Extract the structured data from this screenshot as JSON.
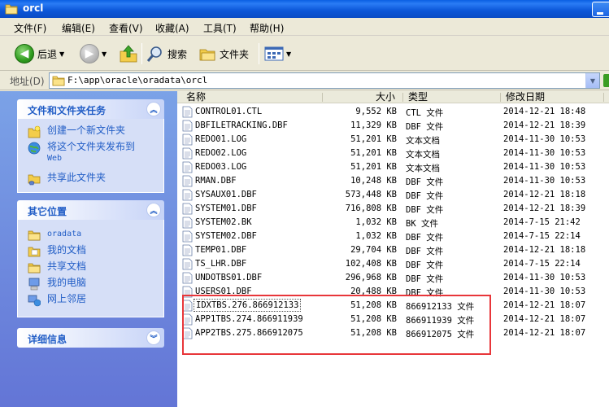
{
  "window": {
    "title": "orcl"
  },
  "menu": [
    {
      "label": "文件(F)"
    },
    {
      "label": "编辑(E)"
    },
    {
      "label": "查看(V)"
    },
    {
      "label": "收藏(A)"
    },
    {
      "label": "工具(T)"
    },
    {
      "label": "帮助(H)"
    }
  ],
  "toolbar": {
    "back_label": "后退",
    "search_label": "搜索",
    "folders_label": "文件夹"
  },
  "address": {
    "label": "地址(D)",
    "path": "F:\\app\\oracle\\oradata\\orcl"
  },
  "tasks": {
    "file_tasks": {
      "title": "文件和文件夹任务",
      "items": [
        {
          "label": "创建一个新文件夹",
          "icon": "new-folder-icon"
        },
        {
          "label": "将这个文件夹发布到",
          "label2": "Web",
          "icon": "publish-web-icon"
        },
        {
          "label": "共享此文件夹",
          "icon": "share-folder-icon"
        }
      ]
    },
    "other_places": {
      "title": "其它位置",
      "items": [
        {
          "label": "oradata",
          "icon": "folder-icon"
        },
        {
          "label": "我的文档",
          "icon": "my-documents-icon"
        },
        {
          "label": "共享文档",
          "icon": "shared-documents-icon"
        },
        {
          "label": "我的电脑",
          "icon": "my-computer-icon"
        },
        {
          "label": "网上邻居",
          "icon": "network-places-icon"
        }
      ]
    },
    "details": {
      "title": "详细信息"
    }
  },
  "columns": {
    "name": "名称",
    "size": "大小",
    "type": "类型",
    "modified": "修改日期"
  },
  "files": [
    {
      "name": "CONTROL01.CTL",
      "size": "9,552 KB",
      "type": "CTL 文件",
      "modified": "2014-12-21 18:48"
    },
    {
      "name": "DBFILETRACKING.DBF",
      "size": "11,329 KB",
      "type": "DBF 文件",
      "modified": "2014-12-21 18:39"
    },
    {
      "name": "REDO01.LOG",
      "size": "51,201 KB",
      "type": "文本文档",
      "modified": "2014-11-30 10:53"
    },
    {
      "name": "REDO02.LOG",
      "size": "51,201 KB",
      "type": "文本文档",
      "modified": "2014-11-30 10:53"
    },
    {
      "name": "REDO03.LOG",
      "size": "51,201 KB",
      "type": "文本文档",
      "modified": "2014-11-30 10:53"
    },
    {
      "name": "RMAN.DBF",
      "size": "10,248 KB",
      "type": "DBF 文件",
      "modified": "2014-11-30 10:53"
    },
    {
      "name": "SYSAUX01.DBF",
      "size": "573,448 KB",
      "type": "DBF 文件",
      "modified": "2014-12-21 18:18"
    },
    {
      "name": "SYSTEM01.DBF",
      "size": "716,808 KB",
      "type": "DBF 文件",
      "modified": "2014-12-21 18:39"
    },
    {
      "name": "SYSTEM02.BK",
      "size": "1,032 KB",
      "type": "BK 文件",
      "modified": "2014-7-15 21:42"
    },
    {
      "name": "SYSTEM02.DBF",
      "size": "1,032 KB",
      "type": "DBF 文件",
      "modified": "2014-7-15 22:14"
    },
    {
      "name": "TEMP01.DBF",
      "size": "29,704 KB",
      "type": "DBF 文件",
      "modified": "2014-12-21 18:18"
    },
    {
      "name": "TS_LHR.DBF",
      "size": "102,408 KB",
      "type": "DBF 文件",
      "modified": "2014-7-15 22:14"
    },
    {
      "name": "UNDOTBS01.DBF",
      "size": "296,968 KB",
      "type": "DBF 文件",
      "modified": "2014-11-30 10:53"
    },
    {
      "name": "USERS01.DBF",
      "size": "20,488 KB",
      "type": "DBF 文件",
      "modified": "2014-11-30 10:53"
    },
    {
      "name": "IDXTBS.276.866912133",
      "size": "51,208 KB",
      "type": "866912133 文件",
      "modified": "2014-12-21 18:07"
    },
    {
      "name": "APP1TBS.274.866911939",
      "size": "51,208 KB",
      "type": "866911939 文件",
      "modified": "2014-12-21 18:07"
    },
    {
      "name": "APP2TBS.275.866912075",
      "size": "51,208 KB",
      "type": "866912075 文件",
      "modified": "2014-12-21 18:07"
    }
  ],
  "colors": {
    "highlight_box": "#e8363a",
    "task_link": "#215dc6",
    "title_bar": "#0a5fe3"
  }
}
